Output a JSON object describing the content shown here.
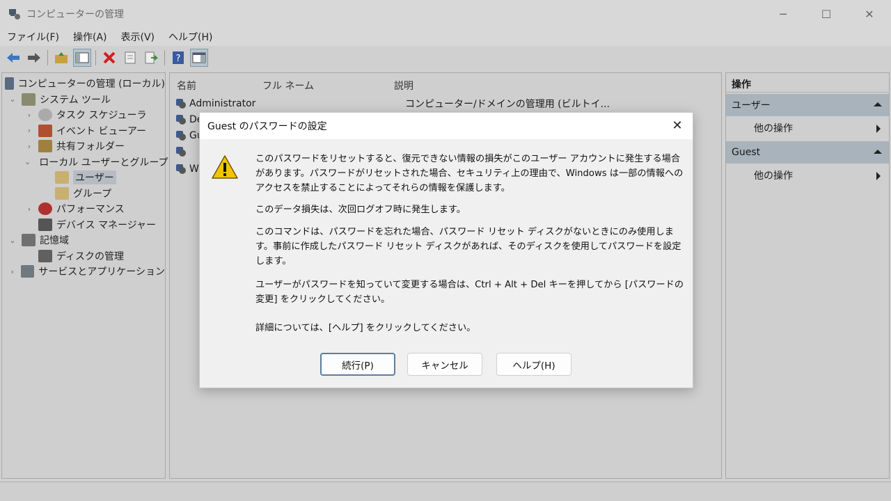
{
  "window": {
    "title": "コンピューターの管理",
    "min": "─",
    "max": "☐",
    "close": "✕"
  },
  "menu": [
    "ファイル(F)",
    "操作(A)",
    "表示(V)",
    "ヘルプ(H)"
  ],
  "tree": {
    "root": "コンピューターの管理 (ローカル)",
    "system_tools": "システム ツール",
    "task_scheduler": "タスク スケジューラ",
    "event_viewer": "イベント ビューアー",
    "shared_folders": "共有フォルダー",
    "local_users": "ローカル ユーザーとグループ",
    "users": "ユーザー",
    "groups": "グループ",
    "performance": "パフォーマンス",
    "device_manager": "デバイス マネージャー",
    "storage": "記憶域",
    "disk_management": "ディスクの管理",
    "services_apps": "サービスとアプリケーション"
  },
  "list": {
    "col_name": "名前",
    "col_fullname": "フル ネーム",
    "col_desc": "説明",
    "rows": [
      {
        "name": "Administrator",
        "desc": "コンピューター/ドメインの管理用 (ビルトイ..."
      },
      {
        "name": "De",
        "desc": ""
      },
      {
        "name": "Gu",
        "desc": ""
      },
      {
        "name": "",
        "desc": ""
      },
      {
        "name": "W",
        "desc": ""
      }
    ]
  },
  "actions": {
    "header": "操作",
    "section1": "ユーザー",
    "section1_item": "他の操作",
    "section2": "Guest",
    "section2_item": "他の操作"
  },
  "dialog": {
    "title": "Guest のパスワードの設定",
    "close": "✕",
    "p1": "このパスワードをリセットすると、復元できない情報の損失がこのユーザー アカウントに発生する場合があります。パスワードがリセットされた場合、セキュリティ上の理由で、Windows は一部の情報へのアクセスを禁止することによってそれらの情報を保護します。",
    "p2": "このデータ損失は、次回ログオフ時に発生します。",
    "p3": "このコマンドは、パスワードを忘れた場合、パスワード リセット ディスクがないときにのみ使用します。事前に作成したパスワード リセット ディスクがあれば、そのディスクを使用してパスワードを設定します。",
    "p4": "ユーザーがパスワードを知っていて変更する場合は、Ctrl + Alt + Del キーを押してから [パスワードの変更] をクリックしてください。",
    "p5": "詳細については、[ヘルプ] をクリックしてください。",
    "btn_proceed": "続行(P)",
    "btn_cancel": "キャンセル",
    "btn_help": "ヘルプ(H)"
  }
}
